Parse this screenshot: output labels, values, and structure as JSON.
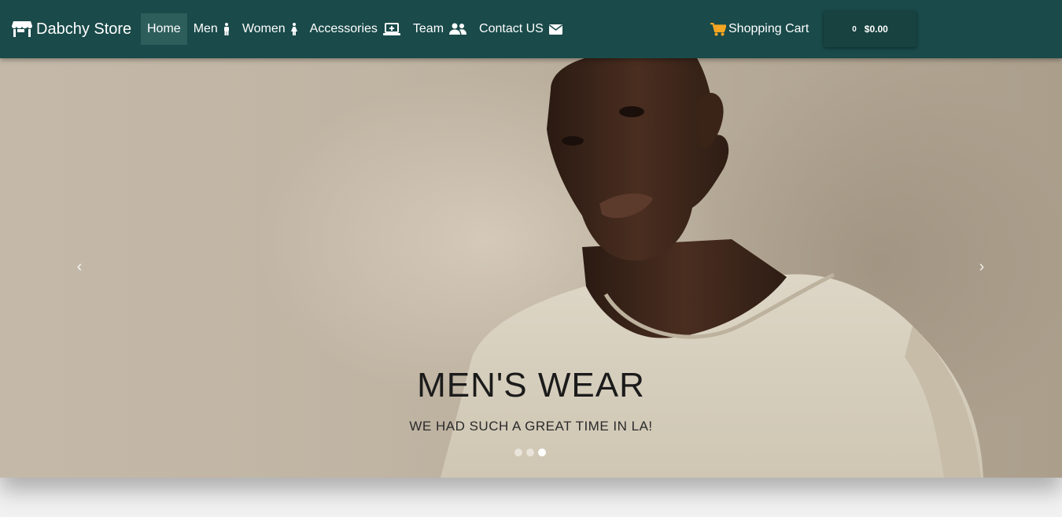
{
  "brand": {
    "name": "Dabchy Store",
    "icon": "store-icon"
  },
  "nav": {
    "items": [
      {
        "label": "Home",
        "icon": "",
        "active": true
      },
      {
        "label": "Men",
        "icon": "male-icon",
        "active": false
      },
      {
        "label": "Women",
        "icon": "female-icon",
        "active": false
      },
      {
        "label": "Accessories",
        "icon": "laptop-icon",
        "active": false
      },
      {
        "label": "Team",
        "icon": "users-icon",
        "active": false
      },
      {
        "label": "Contact US",
        "icon": "envelope-icon",
        "active": false
      }
    ]
  },
  "cart": {
    "link_label": "Shopping Cart",
    "count": "0",
    "total": "$0.00",
    "icon": "shopping-cart-icon"
  },
  "hero": {
    "title": "MEN'S WEAR",
    "subtitle": "WE HAD SUCH A GREAT TIME IN LA!",
    "prev_arrow": "‹",
    "next_arrow": "›",
    "slides": 3,
    "active_slide": 3
  },
  "colors": {
    "navbar": "#1a4a4a",
    "active_nav": "#2e5e5c",
    "cart_box": "#17423f",
    "cart_icon": "#f5a623"
  }
}
